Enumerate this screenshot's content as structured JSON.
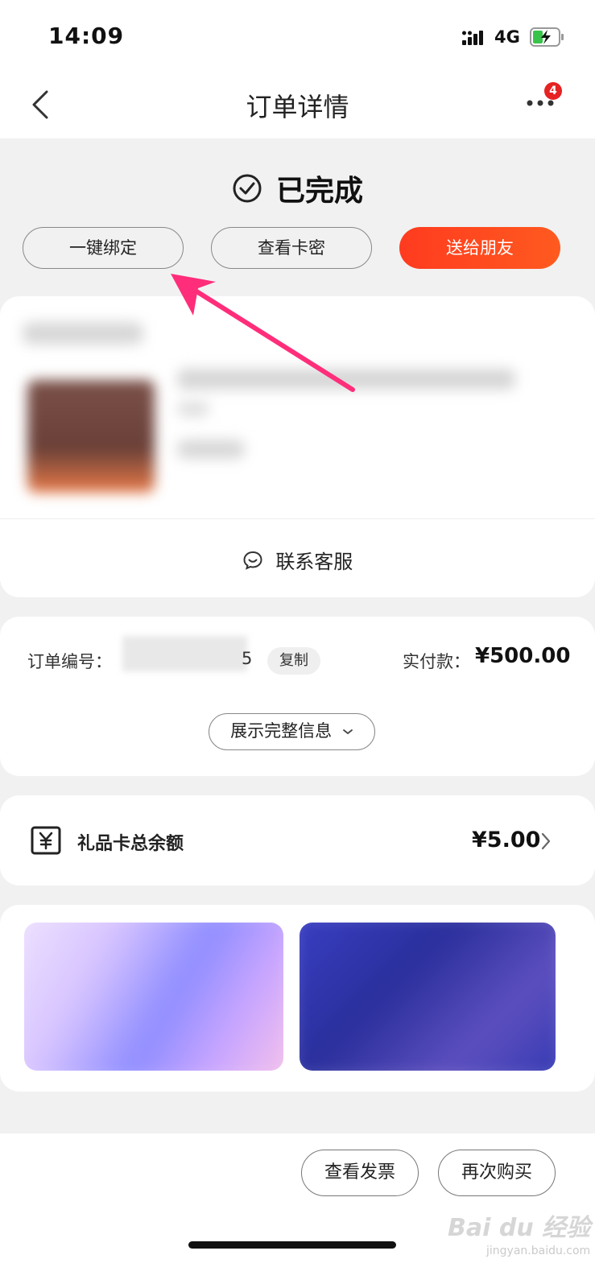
{
  "status_bar": {
    "time": "14:09",
    "network": "4G",
    "icons": [
      "signal-icon",
      "battery-charging-icon"
    ]
  },
  "nav": {
    "title": "订单详情",
    "badge": "4",
    "icons": [
      "back-arrow-icon",
      "more-icon"
    ]
  },
  "order_status": {
    "text": "已完成",
    "icon": "check-circle-icon"
  },
  "actions": {
    "bind": "一键绑定",
    "view_card": "查看卡密",
    "send_friend": "送给朋友"
  },
  "product": {
    "contact_label": "联系客服",
    "contact_icon": "chat-smile-icon"
  },
  "order_info": {
    "order_no_label": "订单编号：",
    "order_no_tail": "5",
    "copy_label": "复制",
    "paid_label": "实付款：",
    "paid_value": "¥500.00",
    "expand_label": "展示完整信息"
  },
  "gift_card": {
    "label": "礼品卡总余额",
    "value": "¥5.00",
    "icon": "yuan-box-icon"
  },
  "bottom": {
    "invoice_label": "查看发票",
    "rebuy_label": "再次购买"
  },
  "watermark": {
    "brand": "Bai du 经验",
    "url": "jingyan.baidu.com"
  },
  "colors": {
    "accent": "#ff4a1f",
    "badge": "#e62222",
    "annotation_arrow": "#ff2d7a",
    "background": "#f1f1f1"
  }
}
